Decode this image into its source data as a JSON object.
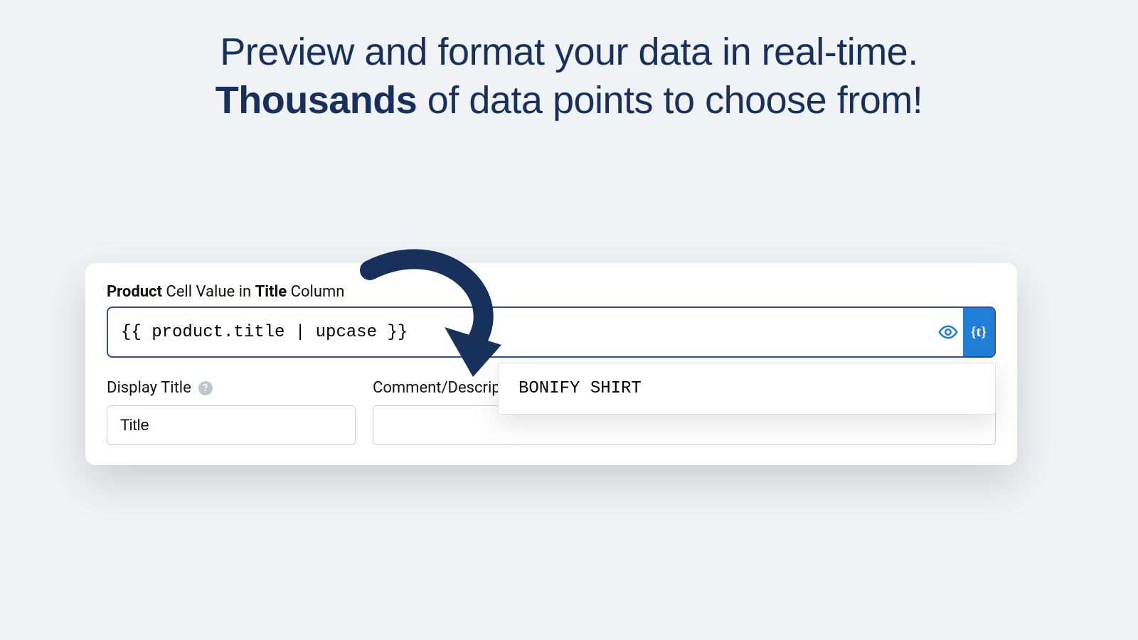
{
  "headline": {
    "line1": "Preview and format your data in real-time.",
    "line2_strong": "Thousands",
    "line2_rest": " of data points to choose from!"
  },
  "card": {
    "label_bold1": "Product",
    "label_mid": " Cell Value in ",
    "label_bold2": "Title",
    "label_end": " Column",
    "template_value": "{{ product.title | upcase }}",
    "tag_button_text": "{t}",
    "display_title_label": "Display Title",
    "display_title_value": "Title",
    "comment_label": "Comment/Description",
    "comment_value": ""
  },
  "preview": {
    "value": "BONIFY SHIRT"
  }
}
